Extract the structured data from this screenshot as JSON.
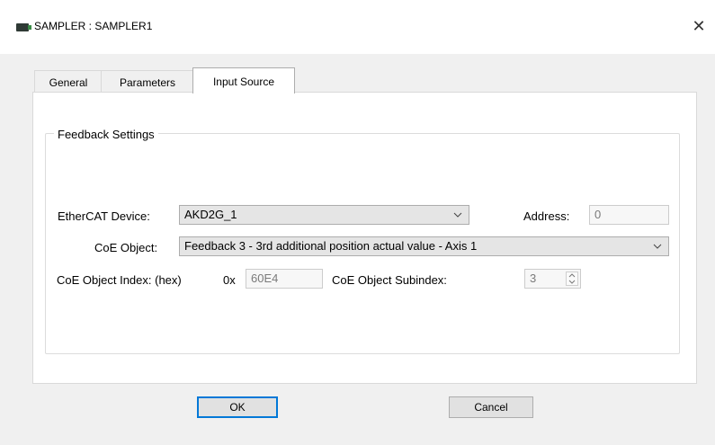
{
  "window": {
    "title": "SAMPLER : SAMPLER1",
    "close_glyph": "✕"
  },
  "tabs": [
    {
      "label": "General",
      "active": false
    },
    {
      "label": "Parameters",
      "active": false
    },
    {
      "label": "Input Source",
      "active": true
    }
  ],
  "group": {
    "legend": "Feedback Settings"
  },
  "form": {
    "device_label": "EtherCAT Device:",
    "device_value": "AKD2G_1",
    "address_label": "Address:",
    "address_value": "0",
    "coe_object_label": "CoE Object:",
    "coe_object_value": "Feedback 3 - 3rd additional position actual value - Axis 1",
    "coe_index_label": "CoE Object Index: (hex)",
    "coe_index_prefix": "0x",
    "coe_index_value": "60E4",
    "coe_subindex_label": "CoE Object Subindex:",
    "coe_subindex_value": "3"
  },
  "buttons": {
    "ok": "OK",
    "cancel": "Cancel"
  },
  "icons": {
    "app": "sampler-app-icon",
    "dropdown": "chevron-down-icon",
    "spin": "spin-updown-icon"
  }
}
